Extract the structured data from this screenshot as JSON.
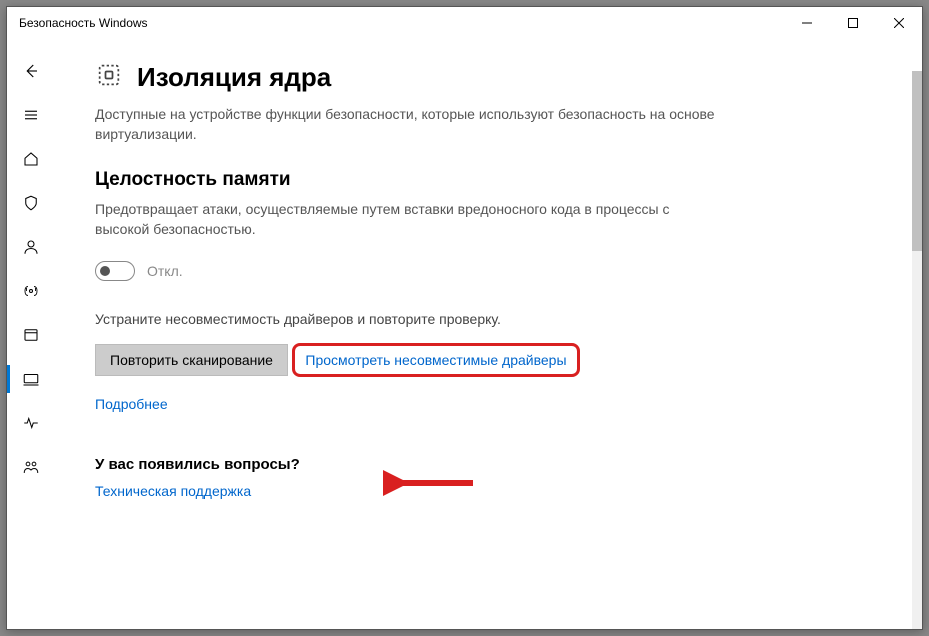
{
  "window": {
    "title": "Безопасность Windows"
  },
  "page": {
    "heading": "Изоляция ядра",
    "description": "Доступные на устройстве функции безопасности, которые используют безопасность на основе виртуализации.",
    "section_title": "Целостность памяти",
    "section_desc": "Предотвращает атаки, осуществляемые путем вставки вредоносного кода в процессы с высокой безопасностью.",
    "toggle_state": "Откл.",
    "fix_note": "Устраните несовместимость драйверов и повторите проверку.",
    "rescan_button": "Повторить сканирование",
    "view_drivers_link": "Просмотреть несовместимые драйверы",
    "learn_more_link": "Подробнее",
    "questions_heading": "У вас появились вопросы?",
    "support_link": "Техническая поддержка"
  }
}
